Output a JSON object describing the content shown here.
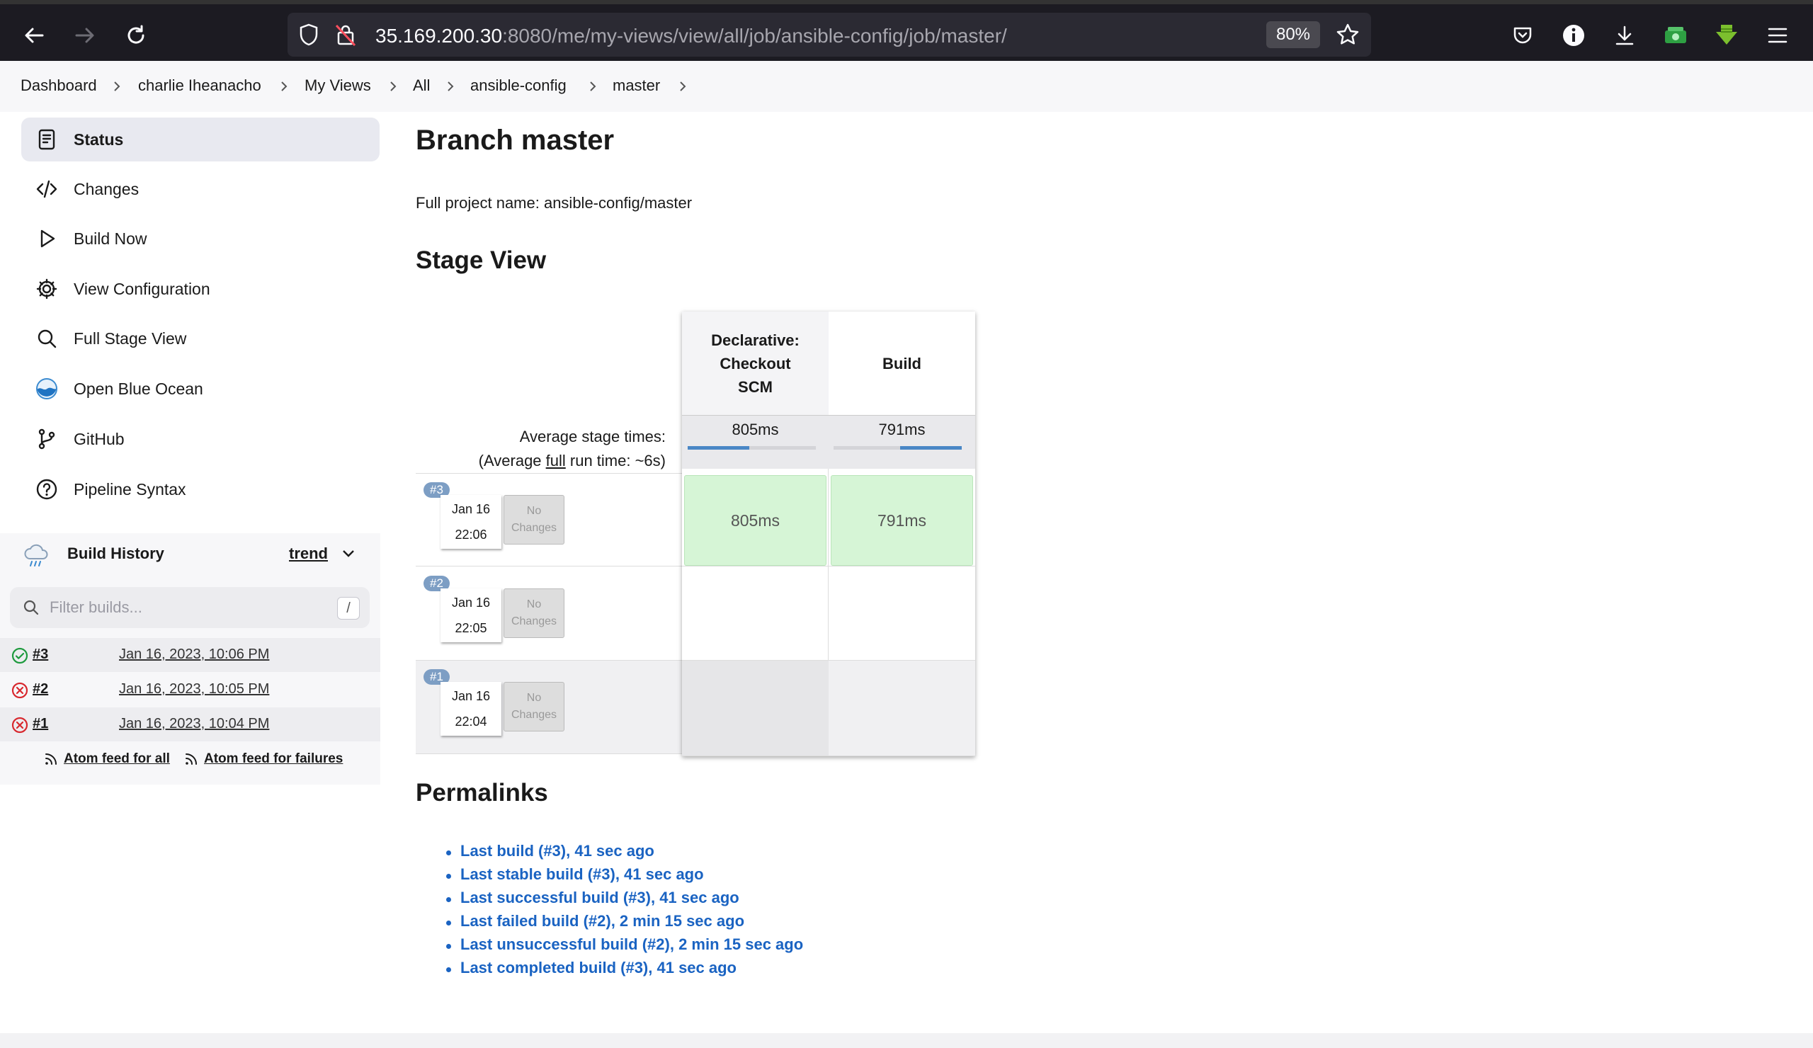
{
  "browser": {
    "url_host": "35.169.200.30",
    "url_path": ":8080/me/my-views/view/all/job/ansible-config/job/master/",
    "zoom": "80%"
  },
  "breadcrumb": [
    "Dashboard",
    "charlie Iheanacho",
    "My Views",
    "All",
    "ansible-config",
    "master"
  ],
  "sidebar": {
    "items": [
      {
        "label": "Status",
        "icon": "status-icon"
      },
      {
        "label": "Changes",
        "icon": "code-icon"
      },
      {
        "label": "Build Now",
        "icon": "play-icon"
      },
      {
        "label": "View Configuration",
        "icon": "gear-icon"
      },
      {
        "label": "Full Stage View",
        "icon": "search-icon"
      },
      {
        "label": "Open Blue Ocean",
        "icon": "blue-ocean-icon"
      },
      {
        "label": "GitHub",
        "icon": "git-branch-icon"
      },
      {
        "label": "Pipeline Syntax",
        "icon": "help-icon"
      }
    ]
  },
  "build_history": {
    "title": "Build History",
    "trend_label": "trend",
    "filter_placeholder": "Filter builds...",
    "filter_shortcut": "/",
    "builds": [
      {
        "num": "#3",
        "date": "Jan 16, 2023, 10:06 PM",
        "status": "success"
      },
      {
        "num": "#2",
        "date": "Jan 16, 2023, 10:05 PM",
        "status": "failed"
      },
      {
        "num": "#1",
        "date": "Jan 16, 2023, 10:04 PM",
        "status": "failed"
      }
    ],
    "feed_all": "Atom feed for all",
    "feed_failures": "Atom feed for failures"
  },
  "main": {
    "title": "Branch master",
    "full_name": "Full project name: ansible-config/master",
    "stage_view_title": "Stage View",
    "avg_label_line1": "Average stage times:",
    "avg_label_pre": "(Average ",
    "avg_label_full": "full",
    "avg_label_post": " run time: ~6s)",
    "stages": [
      {
        "name_lines": [
          "Declarative:",
          "Checkout",
          "SCM"
        ],
        "avg": "805ms",
        "avg_fraction": 0.48
      },
      {
        "name_lines": [
          "Build"
        ],
        "avg": "791ms",
        "avg_fraction": 0.48
      }
    ],
    "runs": [
      {
        "badge": "#3",
        "date": "Jan 16",
        "time": "22:06",
        "changes_line1": "No",
        "changes_line2": "Changes",
        "cells": [
          "805ms",
          "791ms"
        ]
      },
      {
        "badge": "#2",
        "date": "Jan 16",
        "time": "22:05",
        "changes_line1": "No",
        "changes_line2": "Changes",
        "cells": [
          "",
          ""
        ]
      },
      {
        "badge": "#1",
        "date": "Jan 16",
        "time": "22:04",
        "changes_line1": "No",
        "changes_line2": "Changes",
        "cells": [
          "",
          ""
        ]
      }
    ],
    "permalinks_title": "Permalinks",
    "permalinks": [
      "Last build (#3), 41 sec ago",
      "Last stable build (#3), 41 sec ago",
      "Last successful build (#3), 41 sec ago",
      "Last failed build (#2), 2 min 15 sec ago",
      "Last unsuccessful build (#2), 2 min 15 sec ago",
      "Last completed build (#3), 41 sec ago"
    ]
  },
  "colors": {
    "success_cell": "#d6f5d6",
    "link_blue": "#1a63c2",
    "failed_red": "#d8282e",
    "success_green": "#1e9a3e"
  }
}
